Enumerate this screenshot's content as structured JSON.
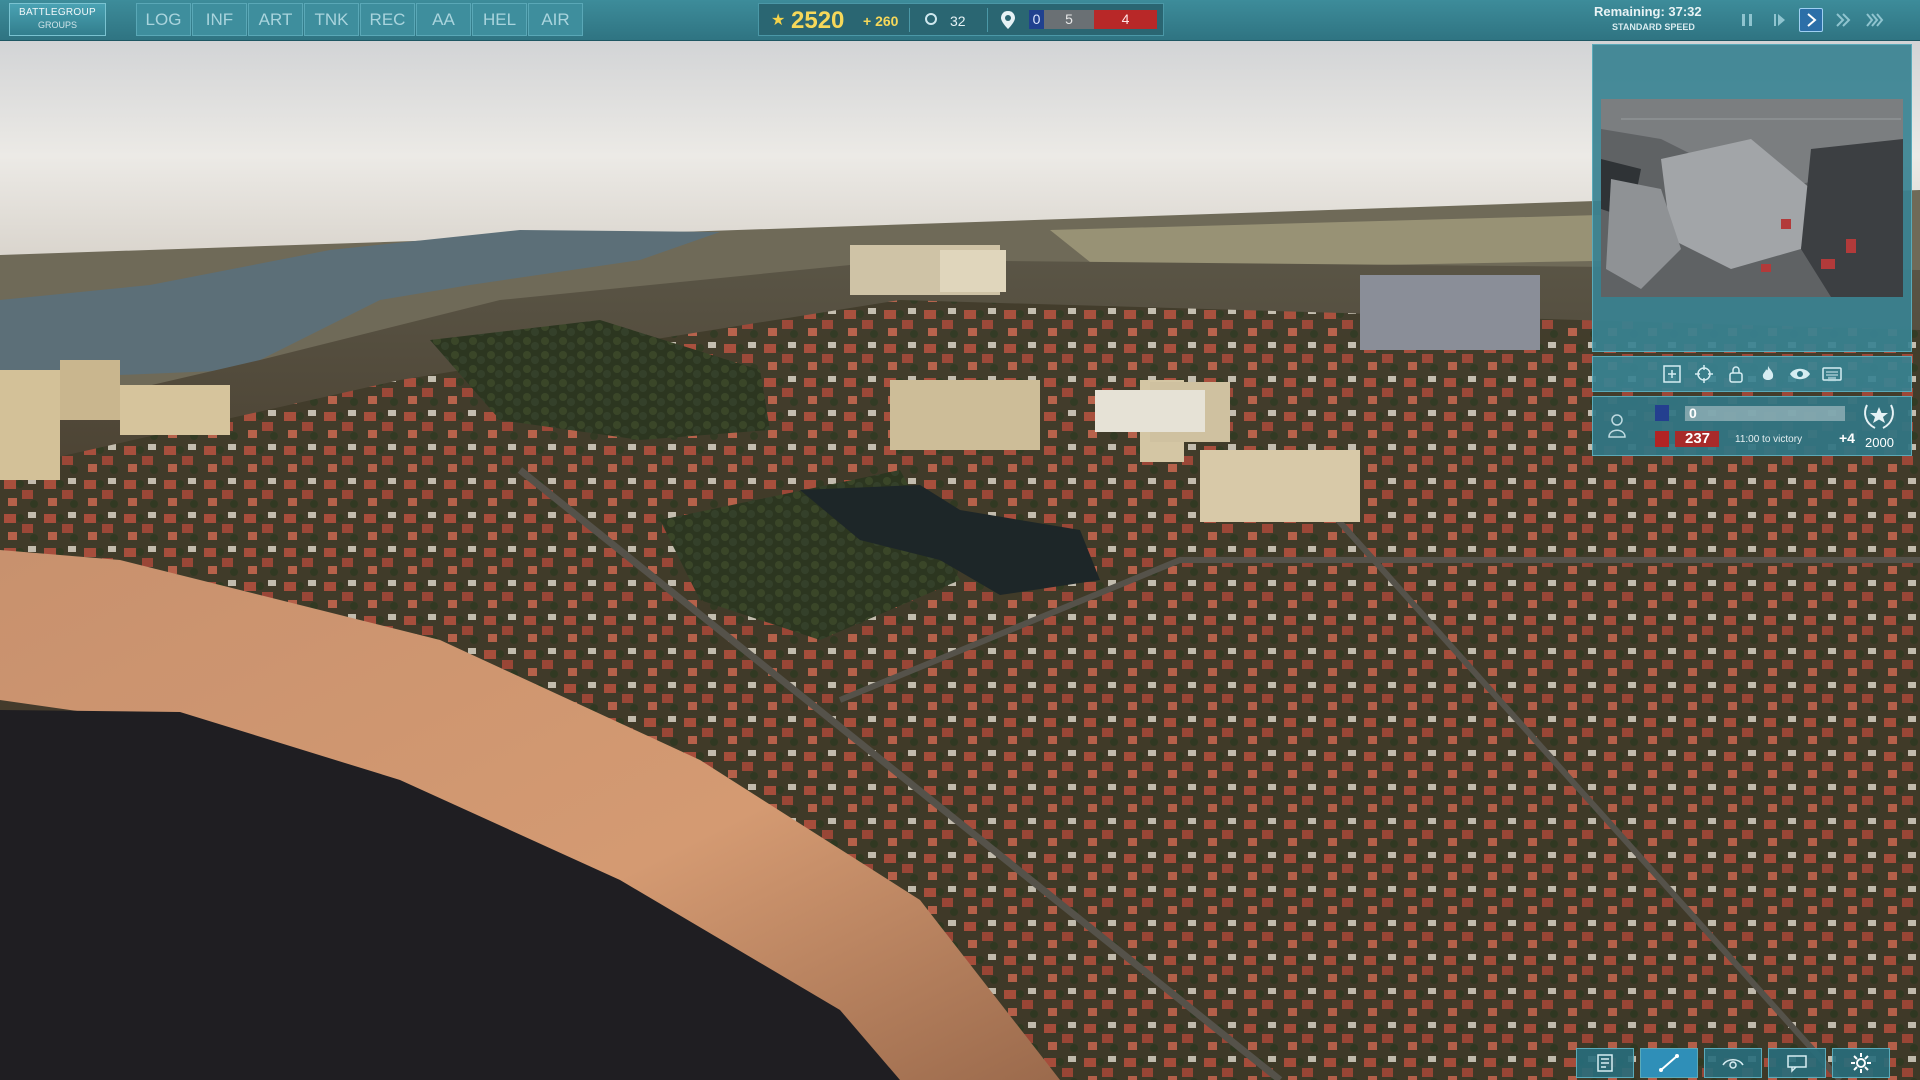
{
  "battlegroup": {
    "line1": "BATTLEGROUP",
    "line2": "GROUPS"
  },
  "filters": [
    "LOG",
    "INF",
    "ART",
    "TNK",
    "REC",
    "AA",
    "HEL",
    "AIR"
  ],
  "resources": {
    "points": "2520",
    "income": "+ 260",
    "count": "32"
  },
  "score": {
    "blue": "0",
    "neutral": "5",
    "red": "4"
  },
  "time": {
    "remaining": "Remaining: 37:32",
    "speed": "STANDARD SPEED"
  },
  "speed_controls": [
    "pause-icon",
    "step-icon",
    "play-icon",
    "fast-icon",
    "fastest-icon"
  ],
  "map_tools": [
    "zoom-fit-icon",
    "crosshair-icon",
    "lock-icon",
    "fire-icon",
    "eye-icon",
    "keyboard-icon"
  ],
  "victory": {
    "blue_points": "0",
    "red_points": "237",
    "time_to_victory": "11:00 to victory",
    "rate": "+4",
    "target": "2000"
  },
  "bottom_tools": [
    "notes-icon",
    "draw-line-icon",
    "visibility-icon",
    "chat-icon",
    "settings-icon"
  ],
  "colors": {
    "ui_teal": "#3d8c9a",
    "blue_team": "#20418f",
    "red_team": "#b82828",
    "gold": "#f6d85a"
  }
}
